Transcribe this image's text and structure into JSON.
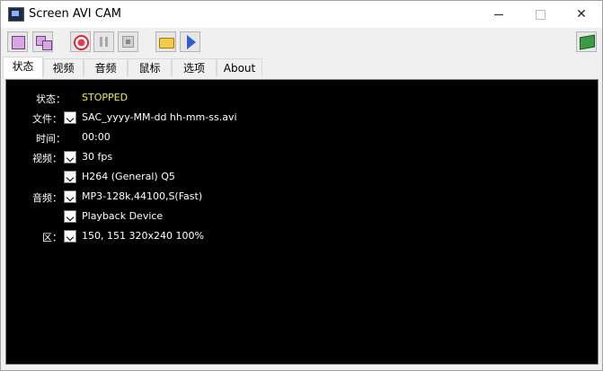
{
  "window": {
    "title": "Screen AVI CAM"
  },
  "toolbar": {
    "icons": [
      "select-region-icon",
      "select-window-icon",
      "record-icon",
      "pause-icon",
      "stop-icon",
      "open-folder-icon",
      "play-icon",
      "help-book-icon"
    ]
  },
  "tabs": [
    "状态",
    "视频",
    "音频",
    "鼠标",
    "选项",
    "About"
  ],
  "status_panel": {
    "status_label": "状态：",
    "status_value": "STOPPED",
    "status_color": "#f2e84a",
    "file_label": "文件：",
    "file_value": "SAC_yyyy-MM-dd hh-mm-ss.avi",
    "time_label": "时间：",
    "time_value": "00:00",
    "video_label": "视频：",
    "video_fps": "30 fps",
    "video_codec": "H264 (General) Q5",
    "audio_label": "音频：",
    "audio_codec": "MP3-128k,44100,S(Fast)",
    "audio_device": "Playback Device",
    "region_label": "区：",
    "region_value": "150, 151  320x240 100%"
  }
}
